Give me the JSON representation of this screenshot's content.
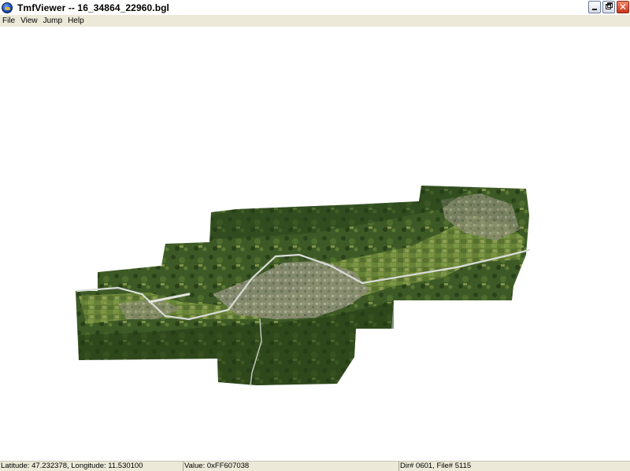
{
  "window": {
    "title": "TmfViewer -- 16_34864_22960.bgl",
    "icon": "globe-icon",
    "buttons": [
      "minimize-icon",
      "restore-icon",
      "close-icon"
    ]
  },
  "menu": {
    "items": [
      "File",
      "View",
      "Jump",
      "Help"
    ]
  },
  "map": {
    "content": "aerial-imagery-tile",
    "colors": {
      "forest": "#2f4a1e",
      "field": "#6f8a3a",
      "urban": "#9a9a86",
      "road": "#d9dcd8",
      "background": "#ffffff"
    }
  },
  "status": {
    "coords": "Latitude: 47.232378, Longitude: 11.530100",
    "value": "Value: 0xFF607038",
    "dir_file": "Dir# 0601, File# 5115"
  }
}
